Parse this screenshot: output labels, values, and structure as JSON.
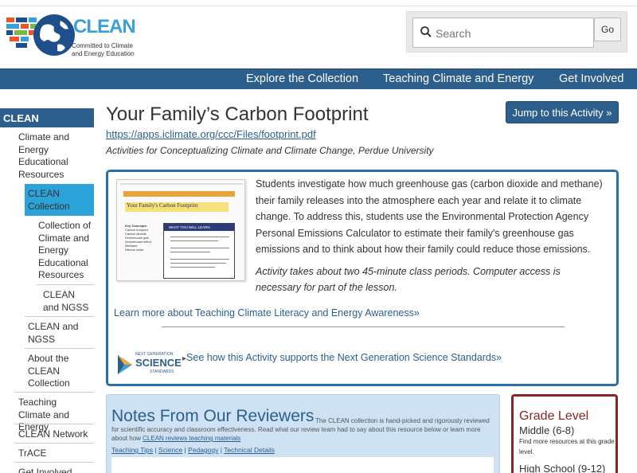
{
  "header": {
    "logo_word": "CLEAN",
    "logo_sub": "Committed to Climate and Energy Education",
    "search_placeholder": "Search",
    "go_label": "Go"
  },
  "nav": [
    "Explore the Collection",
    "Teaching Climate and Energy",
    "Get Involved"
  ],
  "sidebar": {
    "head": "CLEAN",
    "items": [
      "Climate and Energy Educational Resources",
      "CLEAN Collection",
      "Collection of Climate and Energy Educational Resources",
      "CLEAN and NGSS",
      "CLEAN and NGSS",
      "About the CLEAN Collection",
      "Teaching Climate and Energy",
      "CLEAN Network",
      "TrACE",
      "Get Involved"
    ]
  },
  "main": {
    "title": "Your Family’s Carbon Footprint",
    "url": "https://apps.iclimate.org/ccc/Files/footprint.pdf",
    "subtitle": "Activities for Conceptualizing Climate and Climate Change, Perdue University",
    "jump_label": "Jump to this Activity »",
    "description": "Students investigate how much greenhouse gas (carbon dioxide and methane) their family releases into the atmosphere each year and relate it to climate change. To address this, students use the Environmental Protection Agency Personal Emissions Calculator to estimate their family's greenhouse gas emissions and to think about how their family could reduce those emissions.",
    "duration": "Activity takes about two 45-minute class periods. Computer access is necessary for part of the lesson.",
    "learn_link": "Learn more about Teaching Climate Literacy and Energy Awareness»",
    "ngss_link": "See how this Activity supports the Next Generation Science Standards»",
    "ngss_logo": {
      "top": "NEXT GENERATION",
      "mid": "SCIENCE",
      "bot": "STANDARDS"
    },
    "thumb": {
      "band": "Your Family's Carbon Footprint",
      "title": "Your Family's Carbon Footprint",
      "concepts_head": "Key Concepts:",
      "concepts": [
        "Carbon footprint",
        "Carbon dioxide",
        "Greenhouse gas",
        "Greenhouse effect",
        "Methane",
        "Nitrous oxide"
      ],
      "box_head": "WHAT YOU WILL LEARN"
    }
  },
  "notes": {
    "title": "Notes From Our Reviewers",
    "text_a": "The CLEAN collection is hand-picked and rigorously reviewed for scientific accuracy and classroom effectiveness. Read what our review team had to say about this resource below or learn more about how ",
    "text_link": "CLEAN reviews teaching materials",
    "links": [
      "Teaching Tips",
      "Science",
      "Pedagogy",
      "Technical Details"
    ]
  },
  "grade": {
    "title": "Grade Level",
    "middle": "Middle (6-8)",
    "more": "Find more resources at this grade level.",
    "high": "High School (9-12)"
  }
}
